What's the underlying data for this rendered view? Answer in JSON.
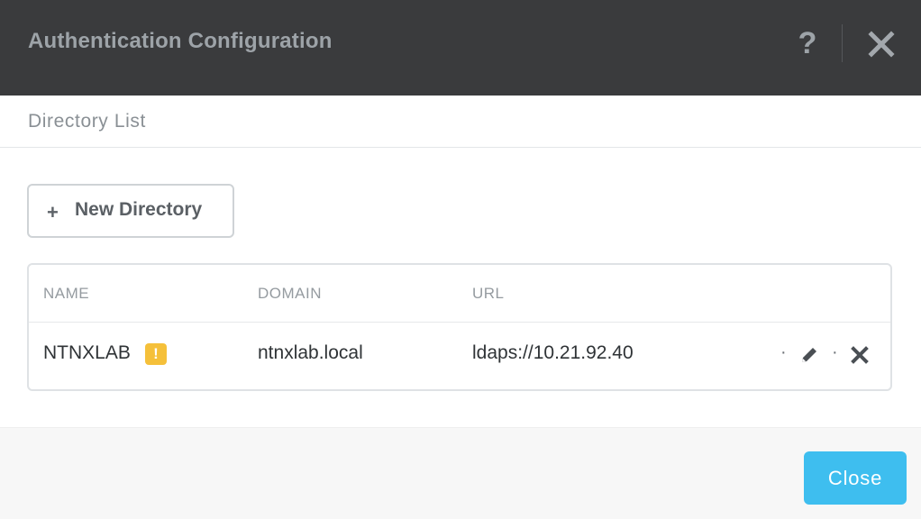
{
  "dialog": {
    "title": "Authentication Configuration",
    "help_icon": "question-mark-icon",
    "close_icon": "close-x-icon"
  },
  "section": {
    "title": "Directory List"
  },
  "toolbar": {
    "new_directory_label": "New Directory",
    "new_directory_icon": "plus-icon"
  },
  "table": {
    "columns": [
      "NAME",
      "DOMAIN",
      "URL"
    ],
    "rows": [
      {
        "name": "NTNXLAB",
        "warning": "!",
        "domain": "ntnxlab.local",
        "url": "ldaps://10.21.92.40",
        "separator": "·",
        "actions": [
          "edit-pencil-icon",
          "delete-x-icon"
        ]
      }
    ]
  },
  "footer": {
    "close_label": "Close"
  },
  "colors": {
    "titlebar_bg": "#3a3b3d",
    "primary_button": "#3ebeef",
    "warning": "#f5c03a"
  }
}
